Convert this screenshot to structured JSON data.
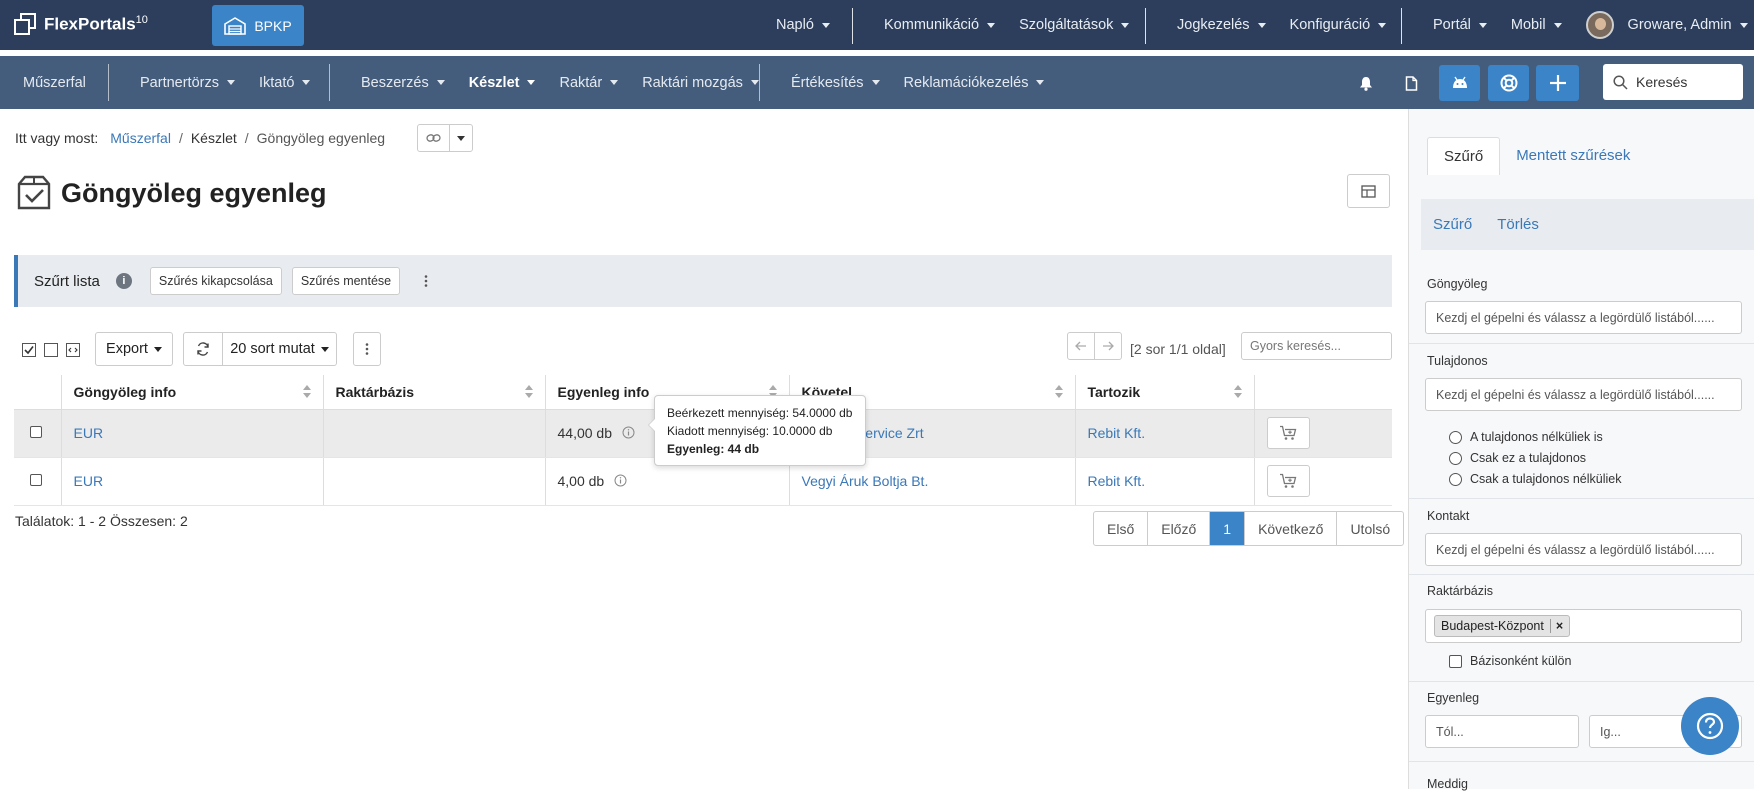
{
  "app": {
    "name": "FlexPortals",
    "version": "10",
    "workspace": "BPKP"
  },
  "topnav": {
    "items": [
      "Napló",
      "Kommunikáció",
      "Szolgáltatások",
      "Jogkezelés",
      "Konfiguráció",
      "Portál",
      "Mobil"
    ],
    "user": "Groware, Admin"
  },
  "subnav": {
    "items": [
      "Műszerfal",
      "Partnertörzs",
      "Iktató",
      "Beszerzés",
      "Készlet",
      "Raktár",
      "Raktári mozgás",
      "Értékesítés",
      "Reklamációkezelés"
    ],
    "active": "Készlet",
    "search_placeholder": "Keresés"
  },
  "breadcrumb": {
    "prefix": "Itt vagy most:",
    "items": [
      "Műszerfal",
      "Készlet",
      "Göngyöleg egyenleg"
    ]
  },
  "page": {
    "title": "Göngyöleg egyenleg"
  },
  "filterbar": {
    "label": "Szűrt lista",
    "info": "i",
    "disable": "Szűrés kikapcsolása",
    "save": "Szűrés mentése"
  },
  "toolbar": {
    "export": "Export",
    "rows": "20 sort mutat",
    "page_info": "[2 sor 1/1 oldal]",
    "quick_search": "Gyors keresés..."
  },
  "table": {
    "columns": [
      "Göngyöleg info",
      "Raktárbázis",
      "Egyenleg info",
      "Követel",
      "Tartozik"
    ],
    "rows": [
      {
        "gongyoleg": "EUR",
        "raktarbazis": "",
        "egyenleg": "44,00 db",
        "kovetel": "Pacsirta Service Zrt",
        "tartozik": "Rebit Kft."
      },
      {
        "gongyoleg": "EUR",
        "raktarbazis": "",
        "egyenleg": "4,00 db",
        "kovetel": "Vegyi Áruk Boltja Bt.",
        "tartozik": "Rebit Kft."
      }
    ]
  },
  "tooltip": {
    "line1": "Beérkezett mennyiség: 54.0000 db",
    "line2": "Kiadott mennyiség: 10.0000 db",
    "line3": "Egyenleg: 44 db"
  },
  "results": "Találatok: 1 - 2 Összesen: 2",
  "pager": {
    "first": "Első",
    "prev": "Előző",
    "current": "1",
    "next": "Következő",
    "last": "Utolsó"
  },
  "panel": {
    "tabs": [
      "Szűrő",
      "Mentett szűrések"
    ],
    "actions": [
      "Szűrő",
      "Törlés"
    ],
    "gongyoleg_label": "Göngyöleg",
    "tulajdonos_label": "Tulajdonos",
    "kontakt_label": "Kontakt",
    "raktarbazis_label": "Raktárbázis",
    "egyenleg_label": "Egyenleg",
    "meddig_label": "Meddig",
    "autocomplete_placeholder": "Kezdj el gépelni és válassz a legördülő listából......",
    "owner_options": [
      "A tulajdonos nélküliek is",
      "Csak ez a tulajdonos",
      "Csak a tulajdonos nélküliek"
    ],
    "raktar_tag": "Budapest-Központ",
    "bazisonkent": "Bázisonként külön",
    "tol_placeholder": "Tól...",
    "ig_placeholder": "Ig..."
  },
  "colors": {
    "topbar": "#2c3e5c",
    "subbar": "#445d7d",
    "accent": "#3a84c7",
    "link": "#3a78b8"
  }
}
